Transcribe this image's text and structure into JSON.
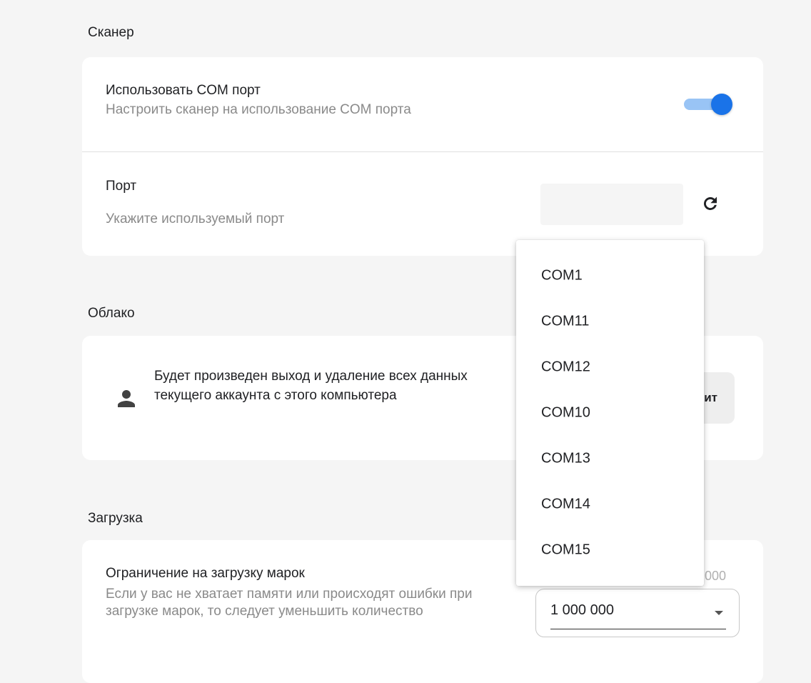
{
  "scanner": {
    "section_title": "Сканер",
    "use_com": {
      "title": "Использовать COM порт",
      "subtitle": "Настроить сканер на использование COM порта",
      "enabled": true
    },
    "port": {
      "title": "Порт",
      "subtitle": "Укажите используемый порт",
      "value": ""
    }
  },
  "cloud": {
    "section_title": "Облако",
    "description": "Будет произведен выход и удаление всех данных текущего аккаунта с этого компьютера",
    "logout_button_visible": "ит"
  },
  "load": {
    "section_title": "Загрузка",
    "limit": {
      "title": "Ограничение на загрузку марок",
      "subtitle": "Если у вас не хватает памяти или происходят ошибки при загрузке марок, то следует уменьшить количество",
      "hint_visible": "000",
      "value": "1 000 000"
    }
  },
  "port_menu": {
    "options": [
      "COM1",
      "COM11",
      "COM12",
      "COM10",
      "COM13",
      "COM14",
      "COM15"
    ]
  },
  "colors": {
    "accent": "#1a73e8",
    "accent_track": "#99c4f5",
    "background": "#f5f5f5"
  }
}
